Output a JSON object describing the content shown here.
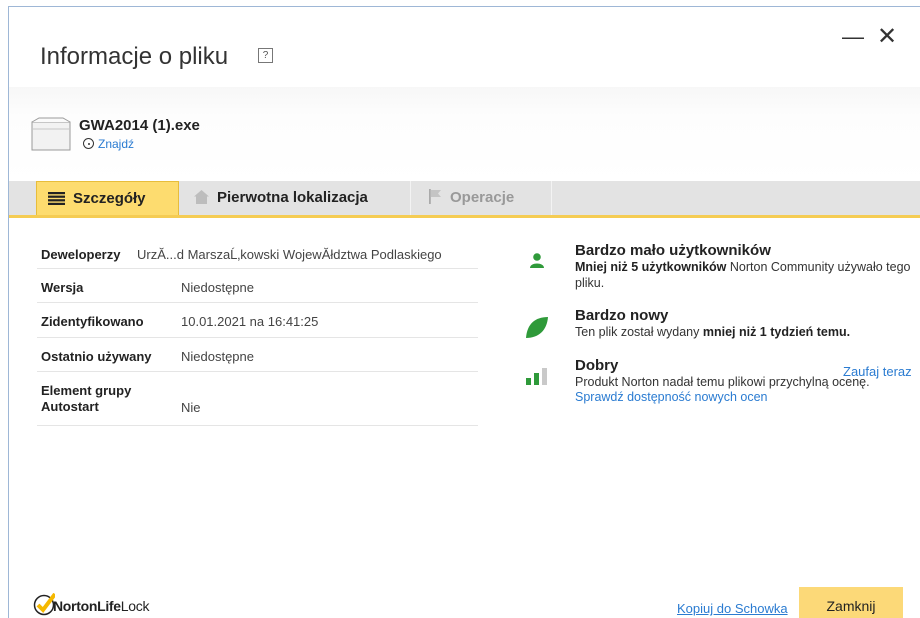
{
  "window": {
    "title": "Informacje o pliku",
    "help_label": "?",
    "minimize_label": "—",
    "close_label": "✕"
  },
  "file": {
    "name": "GWA2014 (1).exe",
    "find_label": "Znajdź"
  },
  "tabs": [
    {
      "label": "Szczegóły",
      "icon": "list-icon",
      "active": true
    },
    {
      "label": "Pierwotna lokalizacja",
      "icon": "home-icon",
      "active": false
    },
    {
      "label": "Operacje",
      "icon": "flag-icon",
      "active": false
    }
  ],
  "details": [
    {
      "label": "Deweloperzy",
      "value": "UrzĂ...d MarszaĹ‚kowski WojewĂłdztwa Podlaskiego"
    },
    {
      "label": "Wersja",
      "value": "Niedostępne"
    },
    {
      "label": "Zidentyfikowano",
      "value": "10.01.2021 na 16:41:25"
    },
    {
      "label": "Ostatnio używany",
      "value": "Niedostępne"
    },
    {
      "label_line1": "Element grupy",
      "label_line2": "Autostart",
      "value": "Nie"
    }
  ],
  "info": {
    "users": {
      "icon": "user-icon",
      "heading": "Bardzo mało użytkowników",
      "text_bold": "Mniej niż 5 użytkowników",
      "text_rest": " Norton Community używało tego pliku."
    },
    "age": {
      "icon": "leaf-icon",
      "heading": "Bardzo nowy",
      "text_pre": "Ten plik został wydany ",
      "text_bold": "mniej niż 1 tydzień temu."
    },
    "rating": {
      "icon": "signal-bars-icon",
      "heading": "Dobry",
      "trust_label": "Zaufaj teraz",
      "text": "Produkt Norton nadał temu plikowi przychylną ocenę.",
      "check_label": "Sprawdź dostępność nowych ocen"
    }
  },
  "footer": {
    "logo_brand": "Norton",
    "logo_life": "Life",
    "logo_lock": "Lock",
    "copy_label": "Kopiuj do Schowka",
    "close_label": "Zamknij"
  },
  "colors": {
    "accent": "#fddc6f",
    "link": "#2a7bd1",
    "green": "#2f9a3a"
  }
}
